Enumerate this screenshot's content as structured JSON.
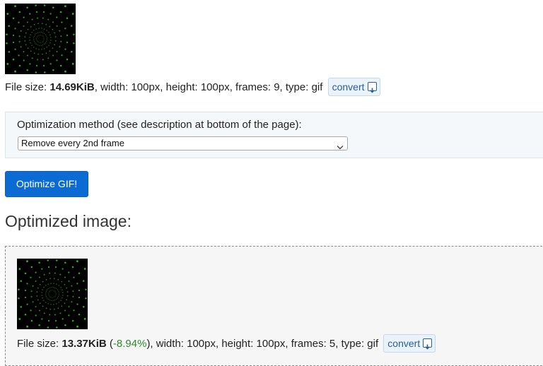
{
  "source": {
    "info": {
      "size_label": "File size:",
      "size_value": "14.69KiB",
      "dims": ", width: 100px, height: 100px, frames: 9, type: gif"
    },
    "convert_label": "convert"
  },
  "optimization": {
    "label": "Optimization method (see description at bottom of the page):",
    "selected": "Remove every 2nd frame"
  },
  "optimize_button": "Optimize GIF!",
  "result": {
    "title": "Optimized image:",
    "info": {
      "size_label": "File size:",
      "size_value": "13.37KiB",
      "paren_open": " (",
      "delta": "-8.94%",
      "dims": "), width: 100px, height: 100px, frames: 5, type: gif"
    },
    "convert_label": "convert"
  },
  "colors": {
    "primary_button": "#0b6bd3",
    "delta_text": "#2e8b2e",
    "gif_dots": "#3fbf2f",
    "gif_background": "#000000"
  },
  "icons": [
    "download-icon",
    "chevron-down-icon"
  ]
}
